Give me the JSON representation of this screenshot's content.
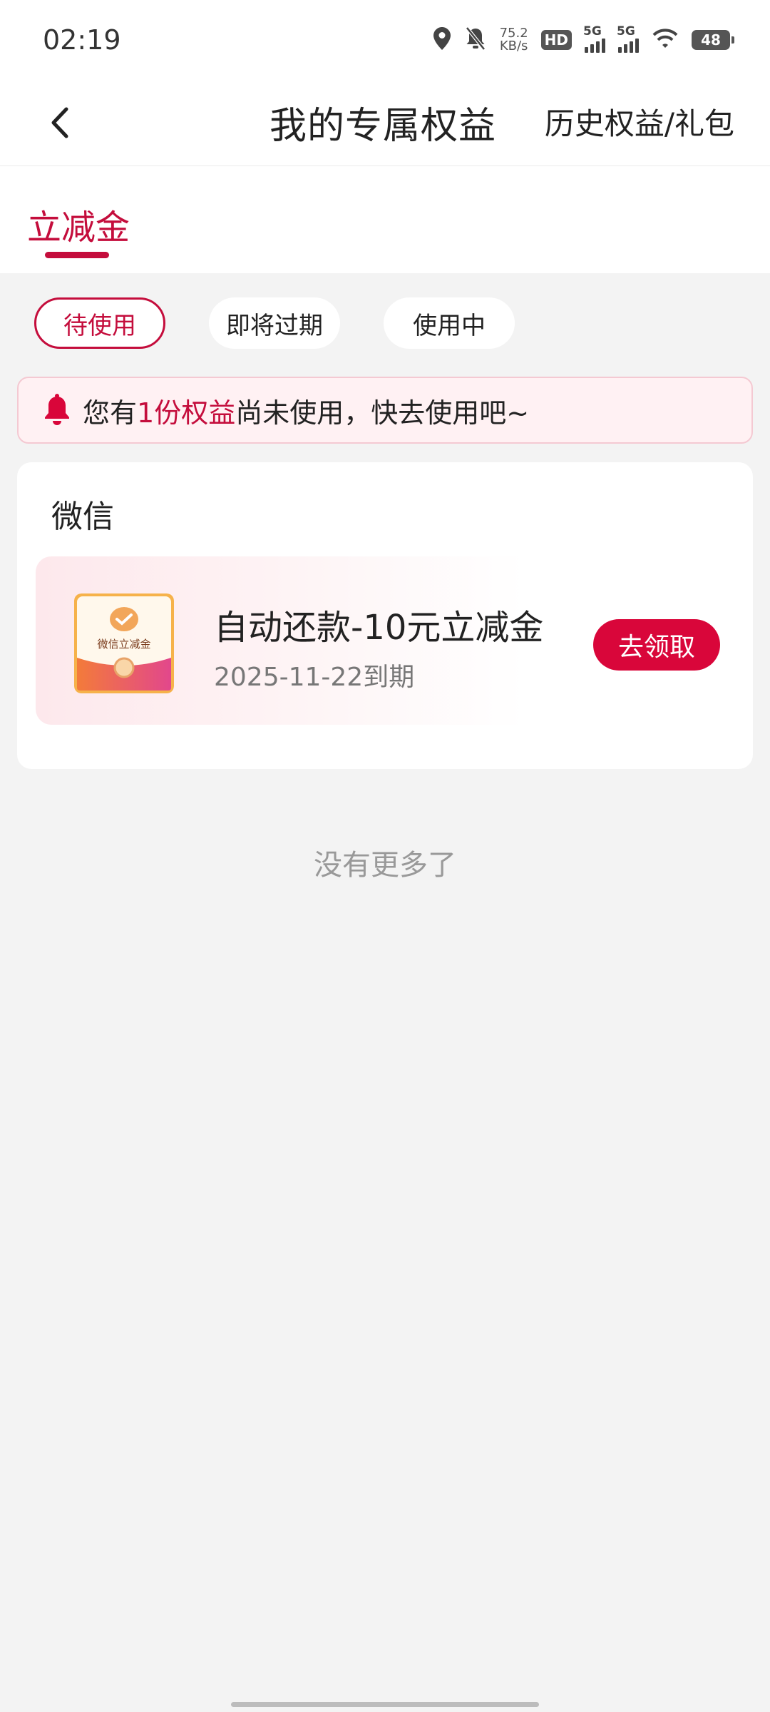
{
  "status_bar": {
    "time": "02:19",
    "net_speed_value": "75.2",
    "net_speed_unit": "KB/s",
    "hd_badge": "HD",
    "sim1_label": "5G",
    "sim2_label": "5G",
    "battery": "48"
  },
  "nav": {
    "title": "我的专属权益",
    "history_link": "历史权益/礼包"
  },
  "tabs": [
    {
      "label": "立减金",
      "active": true
    }
  ],
  "filters": [
    {
      "label": "待使用",
      "active": true
    },
    {
      "label": "即将过期",
      "active": false
    },
    {
      "label": "使用中",
      "active": false
    }
  ],
  "notice": {
    "prefix": "您有",
    "highlight": "1份权益",
    "suffix": "尚未使用，快去使用吧~"
  },
  "card": {
    "title": "微信",
    "item": {
      "icon_text": "微信立减金",
      "name": "自动还款-10元立减金",
      "expiry": "2025-11-22到期",
      "button": "去领取"
    }
  },
  "footer": {
    "no_more": "没有更多了"
  },
  "colors": {
    "accent": "#c40d3c",
    "button": "#d9063a",
    "background": "#f3f3f3"
  }
}
